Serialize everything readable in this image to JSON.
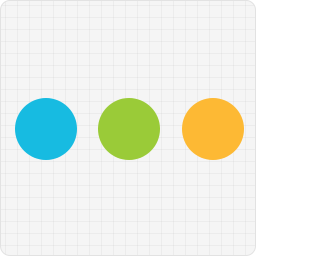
{
  "icon": {
    "name": "three-dots-icon",
    "background": "#f5f5f5",
    "grid_line": "#ebebeb",
    "dots": [
      {
        "name": "blue-dot",
        "color": "#17bbe1"
      },
      {
        "name": "green-dot",
        "color": "#9acb38"
      },
      {
        "name": "orange-dot",
        "color": "#fdb934"
      }
    ]
  }
}
